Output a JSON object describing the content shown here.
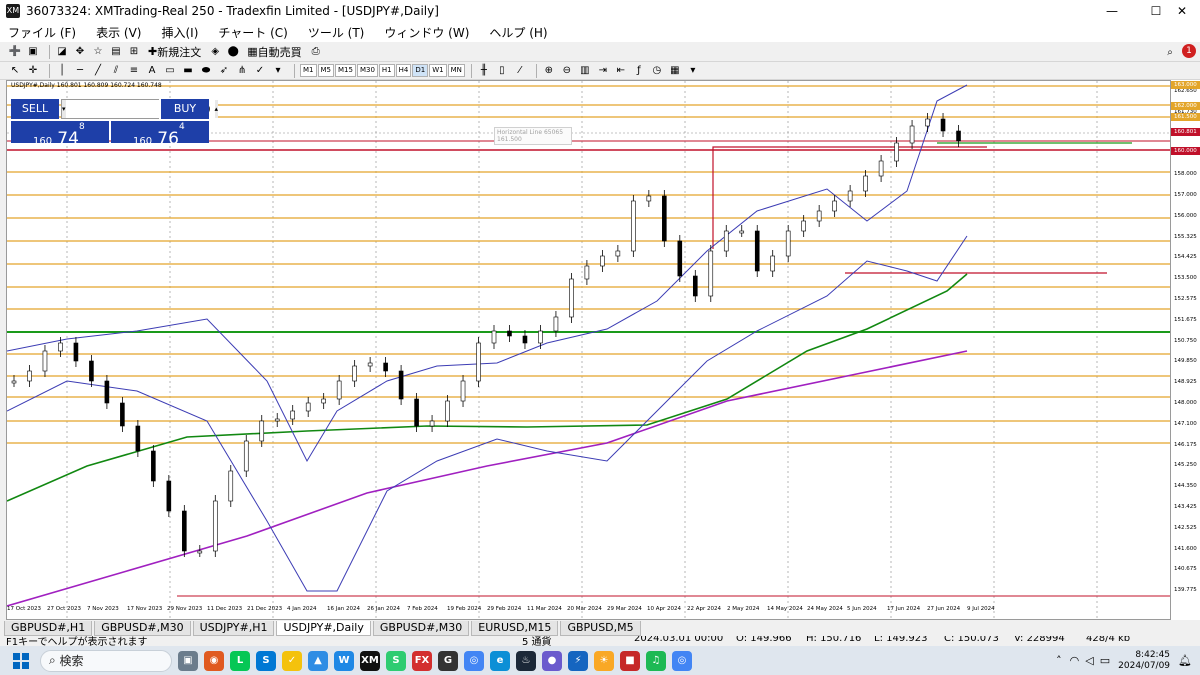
{
  "window": {
    "title": "36073324: XMTrading-Real 250 - Tradexfin Limited - [USDJPY#,Daily]",
    "app_icon": "XM",
    "minimize": "—",
    "maximize": "☐",
    "close": "✕"
  },
  "menu": [
    {
      "label": "ファイル (F)"
    },
    {
      "label": "表示 (V)"
    },
    {
      "label": "挿入(I)"
    },
    {
      "label": "チャート (C)"
    },
    {
      "label": "ツール (T)"
    },
    {
      "label": "ウィンドウ (W)"
    },
    {
      "label": "ヘルプ (H)"
    }
  ],
  "toolbar": {
    "new_order": "新規注文",
    "auto_trade": "自動売買",
    "notification_count": "1"
  },
  "timeframes": [
    "M1",
    "M5",
    "M15",
    "M30",
    "H1",
    "H4",
    "D1",
    "W1",
    "MN"
  ],
  "active_timeframe": "D1",
  "chart": {
    "symbol_line": "USDJPY#,Daily  160.801 160.809 160.724 160.748",
    "lot": "0.10",
    "sell_label": "SELL",
    "buy_label": "BUY",
    "sell_price_big": "160",
    "sell_price_main": "74",
    "sell_price_sup": "8",
    "buy_price_big": "160",
    "buy_price_main": "76",
    "buy_price_sup": "4",
    "hline_label": "Horizontal Line 65065",
    "hline_value": "161.500",
    "bid_tag": "160.801",
    "top_tag": "163.000",
    "level_tag": "162.000",
    "level_tag2": "161.500",
    "level_tag3": "160.000"
  },
  "y_labels": [
    "162.650",
    "161.730",
    "160.801",
    "159.000",
    "158.000",
    "157.000",
    "156.000",
    "155.325",
    "154.425",
    "153.500",
    "152.575",
    "151.675",
    "150.750",
    "149.850",
    "148.925",
    "148.000",
    "147.100",
    "146.175",
    "145.250",
    "144.350",
    "143.425",
    "142.525",
    "141.600",
    "140.675",
    "139.775"
  ],
  "x_labels": [
    "17 Oct 2023",
    "27 Oct 2023",
    "7 Nov 2023",
    "17 Nov 2023",
    "29 Nov 2023",
    "11 Dec 2023",
    "21 Dec 2023",
    "4 Jan 2024",
    "16 Jan 2024",
    "26 Jan 2024",
    "7 Feb 2024",
    "19 Feb 2024",
    "29 Feb 2024",
    "11 Mar 2024",
    "20 Mar 2024",
    "29 Mar 2024",
    "10 Apr 2024",
    "22 Apr 2024",
    "2 May 2024",
    "14 May 2024",
    "24 May 2024",
    "5 Jun 2024",
    "17 Jun 2024",
    "27 Jun 2024",
    "9 Jul 2024"
  ],
  "tabs": [
    {
      "label": "GBPUSD#,H1",
      "active": false
    },
    {
      "label": "GBPUSD#,M30",
      "active": false
    },
    {
      "label": "USDJPY#,H1",
      "active": false
    },
    {
      "label": "USDJPY#,Daily",
      "active": true
    },
    {
      "label": "GBPUSD#,M30",
      "active": false
    },
    {
      "label": "EURUSD,M15",
      "active": false
    },
    {
      "label": "GBPUSD,M5",
      "active": false
    }
  ],
  "status": {
    "help": "F1キーでヘルプが表示されます",
    "profile": "5 通貨",
    "datetime": "2024.03.01 00:00",
    "open": "O: 149.966",
    "high": "H: 150.716",
    "low": "L: 149.923",
    "close": "C: 150.073",
    "volume": "V: 228994",
    "traffic": "428/4 kb"
  },
  "taskbar": {
    "search": "検索",
    "time": "8:42:45",
    "date": "2024/07/09"
  },
  "colors": {
    "sell_blue": "#1e3fa8",
    "level_orange": "#e3a52a",
    "level_red": "#c0102a",
    "ma_green": "#118811",
    "ma_purple": "#a020c0",
    "bb_blue": "#3c3cb4"
  }
}
